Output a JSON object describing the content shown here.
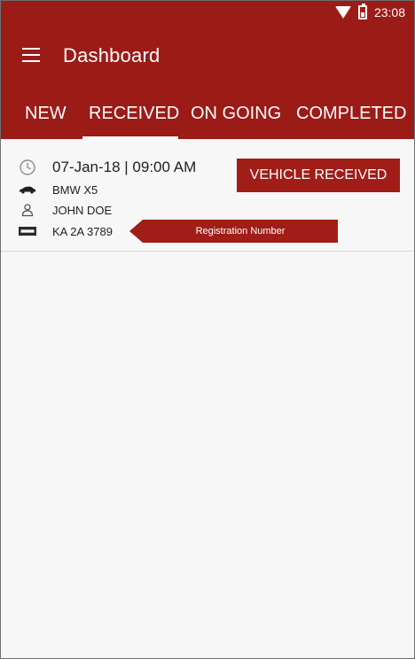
{
  "status_bar": {
    "time": "23:08",
    "icons": [
      "wifi-icon",
      "battery-icon"
    ]
  },
  "app_bar": {
    "title": "Dashboard",
    "menu_icon": "hamburger-icon"
  },
  "tabs": [
    {
      "label": "NEW"
    },
    {
      "label": "RECEIVED"
    },
    {
      "label": "ON GOING"
    },
    {
      "label": "COMPLETED"
    }
  ],
  "selected_tab": "RECEIVED",
  "vehicle": {
    "datetime": "07-Jan-18 | 09:00 AM",
    "model": "BMW X5",
    "owner": "JOHN DOE",
    "registration": "KA 2A 3789",
    "action_label": "VEHICLE RECEIVED",
    "callout": "Registration Number"
  },
  "colors": {
    "primary": "#9b1b17",
    "accent": "#a01d18",
    "background": "#f7f7f7",
    "text": "#1f1f1f"
  }
}
